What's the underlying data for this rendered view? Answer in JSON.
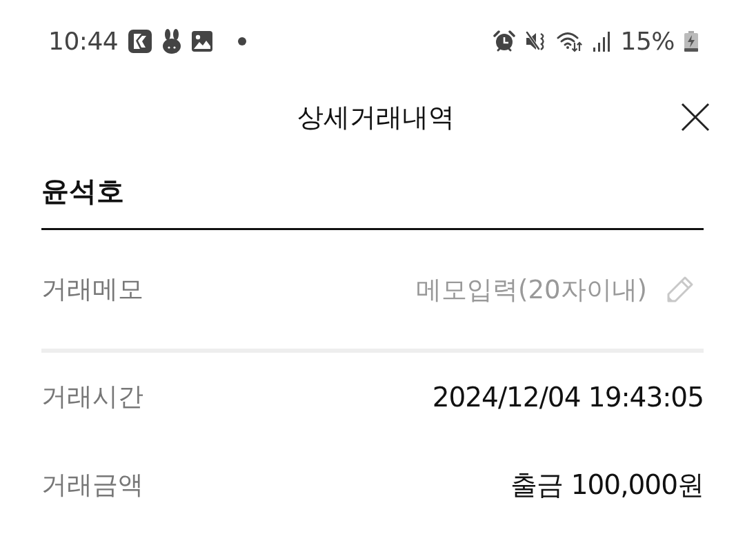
{
  "status_bar": {
    "time": "10:44",
    "battery": "15%"
  },
  "header": {
    "title": "상세거래내역"
  },
  "account": {
    "name": "윤석호"
  },
  "memo": {
    "label": "거래메모",
    "placeholder": "메모입력(20자이내)"
  },
  "details": [
    {
      "label": "거래시간",
      "value": "2024/12/04 19:43:05"
    },
    {
      "label": "거래금액",
      "value": "출금 100,000원"
    }
  ]
}
